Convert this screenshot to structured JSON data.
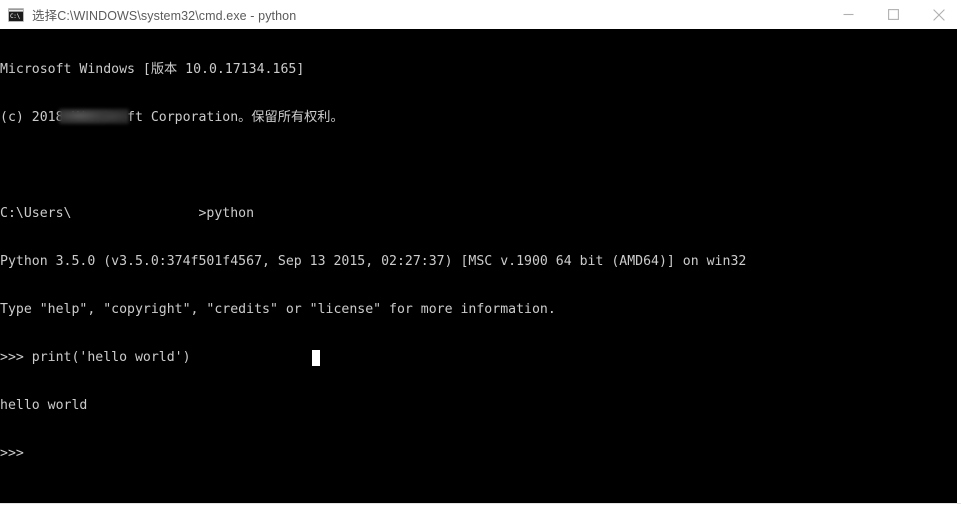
{
  "window": {
    "title": "选择C:\\WINDOWS\\system32\\cmd.exe - python",
    "icon_name": "cmd-console-icon",
    "icon_label": "C:\\",
    "controls": {
      "minimize_label": "Minimize",
      "maximize_label": "Maximize",
      "close_label": "Close"
    },
    "colors": {
      "titlebar_bg": "#ffffff",
      "title_text": "#5b5b5b",
      "console_bg": "#000000",
      "console_text": "#cccccc",
      "cursor": "#ffffff",
      "control_glyph": "#b0b0b0"
    }
  },
  "console": {
    "lines": [
      "Microsoft Windows [版本 10.0.17134.165]",
      "(c) 2018 Microsoft Corporation。保留所有权利。",
      "",
      "C:\\Users\\                >python",
      "Python 3.5.0 (v3.5.0:374f501f4567, Sep 13 2015, 02:27:37) [MSC v.1900 64 bit (AMD64)] on win32",
      "Type \"help\", \"copyright\", \"credits\" or \"license\" for more information.",
      ">>> print('hello world')",
      "hello world",
      ">>>"
    ],
    "redacted_username": "",
    "prompt_symbol": ">>>",
    "cursor_visible": true
  }
}
